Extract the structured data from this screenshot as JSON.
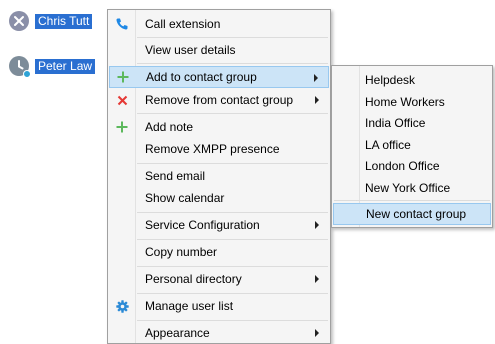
{
  "users": [
    {
      "name": "Chris Tutt",
      "selected": true,
      "icon": "close-icon",
      "presence_color": "#8a8fa8"
    },
    {
      "name": "Peter Law",
      "selected": true,
      "icon": "clock-icon",
      "presence_color": "#2ea3d6"
    }
  ],
  "context_menu": {
    "items": [
      {
        "label": "Call extension",
        "icon": "phone-icon"
      },
      {
        "label": "View user details"
      },
      {
        "label": "Add to contact group",
        "icon": "plus-icon",
        "submenu": true,
        "highlighted": true
      },
      {
        "label": "Remove from contact group",
        "icon": "x-icon",
        "submenu": true
      },
      {
        "label": "Add note",
        "icon": "plus-icon"
      },
      {
        "label": "Remove XMPP presence"
      },
      {
        "label": "Send email"
      },
      {
        "label": "Show calendar"
      },
      {
        "label": "Service Configuration",
        "submenu": true
      },
      {
        "label": "Copy number"
      },
      {
        "label": "Personal directory",
        "submenu": true
      },
      {
        "label": "Manage user list",
        "icon": "gear-icon"
      },
      {
        "label": "Appearance",
        "submenu": true
      }
    ]
  },
  "contact_group_submenu": {
    "items": [
      {
        "label": "Helpdesk"
      },
      {
        "label": "Home Workers"
      },
      {
        "label": "India Office"
      },
      {
        "label": "LA office"
      },
      {
        "label": "London Office"
      },
      {
        "label": "New York Office"
      },
      {
        "label": "New contact group",
        "highlighted": true
      }
    ]
  },
  "colors": {
    "selection": "#2a6fd1",
    "menu_highlight": "#cce4f7",
    "plus_icon": "#5cb85c",
    "x_icon": "#e53935",
    "phone_icon": "#1e88e5",
    "gear_icon": "#2b8ad6"
  }
}
